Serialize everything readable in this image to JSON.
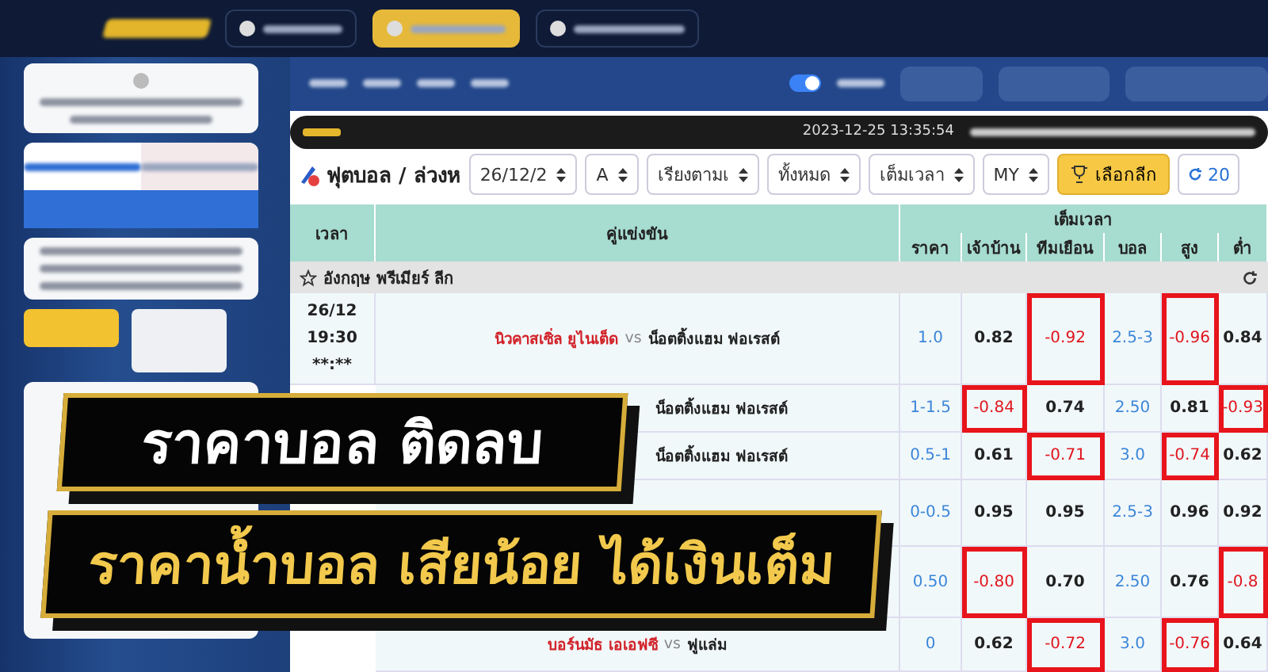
{
  "header": {
    "toggle": {
      "on": true
    }
  },
  "ticker": {
    "timestamp": "2023-12-25 13:35:54"
  },
  "filters": {
    "title": "ฟุตบอล / ล่วงห",
    "selects": [
      "26/12/2",
      "A",
      "เรียงตามเ",
      "ทั้งหมด",
      "เต็มเวลา",
      "MY"
    ],
    "league_button": "เลือกลีก",
    "refresh_count": "20"
  },
  "table": {
    "columns": [
      "เวลา",
      "คู่แข่งขัน"
    ],
    "group": "เต็มเวลา",
    "sub_columns": [
      "ราคา",
      "เจ้าบ้าน",
      "ทีมเยือน",
      "บอล",
      "สูง",
      "ต่ำ"
    ],
    "league": "อังกฤษ พรีเมียร์ ลีก",
    "rows": [
      {
        "time": [
          "26/12",
          "19:30",
          "**:**"
        ],
        "home": "นิวคาสเซิ่ล ยูไนเต็ด",
        "vs": "vs",
        "away": "น็อตติ้งแฮม ฟอเรสต์",
        "cells": [
          {
            "text": "1.0",
            "kind": "line",
            "highlighted": false
          },
          {
            "text": "0.82",
            "kind": "odds",
            "highlighted": false
          },
          {
            "text": "-0.92",
            "kind": "odds",
            "highlighted": true
          },
          {
            "text": "2.5-3",
            "kind": "line",
            "highlighted": false
          },
          {
            "text": "-0.96",
            "kind": "odds",
            "highlighted": true
          },
          {
            "text": "0.84",
            "kind": "odds",
            "highlighted": false
          }
        ]
      },
      {
        "away": "น็อตติ้งแฮม ฟอเรสต์",
        "cells": [
          {
            "text": "1-1.5",
            "kind": "line",
            "highlighted": false
          },
          {
            "text": "-0.84",
            "kind": "odds",
            "highlighted": true
          },
          {
            "text": "0.74",
            "kind": "odds",
            "highlighted": false
          },
          {
            "text": "2.50",
            "kind": "line",
            "highlighted": false
          },
          {
            "text": "0.81",
            "kind": "odds",
            "highlighted": false
          },
          {
            "text": "-0.93",
            "kind": "odds",
            "highlighted": true
          }
        ]
      },
      {
        "away": "น็อตติ้งแฮม ฟอเรสต์",
        "cells": [
          {
            "text": "0.5-1",
            "kind": "line",
            "highlighted": false
          },
          {
            "text": "0.61",
            "kind": "odds",
            "highlighted": false
          },
          {
            "text": "-0.71",
            "kind": "odds",
            "highlighted": true
          },
          {
            "text": "3.0",
            "kind": "line",
            "highlighted": false
          },
          {
            "text": "-0.74",
            "kind": "odds",
            "highlighted": true
          },
          {
            "text": "0.62",
            "kind": "odds",
            "highlighted": false
          }
        ]
      },
      {
        "cells": [
          {
            "text": "0-0.5",
            "kind": "line",
            "highlighted": false
          },
          {
            "text": "0.95",
            "kind": "odds",
            "highlighted": false
          },
          {
            "text": "0.95",
            "kind": "odds",
            "highlighted": false
          },
          {
            "text": "2.5-3",
            "kind": "line",
            "highlighted": false
          },
          {
            "text": "0.96",
            "kind": "odds",
            "highlighted": false
          },
          {
            "text": "0.92",
            "kind": "odds",
            "highlighted": false
          }
        ]
      },
      {
        "cells": [
          {
            "text": "0.50",
            "kind": "line",
            "highlighted": false
          },
          {
            "text": "-0.80",
            "kind": "odds",
            "highlighted": true
          },
          {
            "text": "0.70",
            "kind": "odds",
            "highlighted": false
          },
          {
            "text": "2.50",
            "kind": "line",
            "highlighted": false
          },
          {
            "text": "0.76",
            "kind": "odds",
            "highlighted": false
          },
          {
            "text": "-0.8",
            "kind": "odds",
            "highlighted": true
          }
        ]
      },
      {
        "home": "บอร์นมัธ เอเอฟซี",
        "vs": "vs",
        "away": "ฟูแล่ม",
        "cells": [
          {
            "text": "0",
            "kind": "line",
            "highlighted": false
          },
          {
            "text": "0.62",
            "kind": "odds",
            "highlighted": false
          },
          {
            "text": "-0.72",
            "kind": "odds",
            "highlighted": true
          },
          {
            "text": "3.0",
            "kind": "line",
            "highlighted": false
          },
          {
            "text": "-0.76",
            "kind": "odds",
            "highlighted": true
          },
          {
            "text": "0.64",
            "kind": "odds",
            "highlighted": false
          }
        ]
      }
    ]
  },
  "banners": [
    {
      "text": "ราคาบอล ติดลบ",
      "kind": "white"
    },
    {
      "text": "ราคาน้ำบอล เสียน้อย ได้เงินเต็ม",
      "kind": "gold"
    }
  ]
}
